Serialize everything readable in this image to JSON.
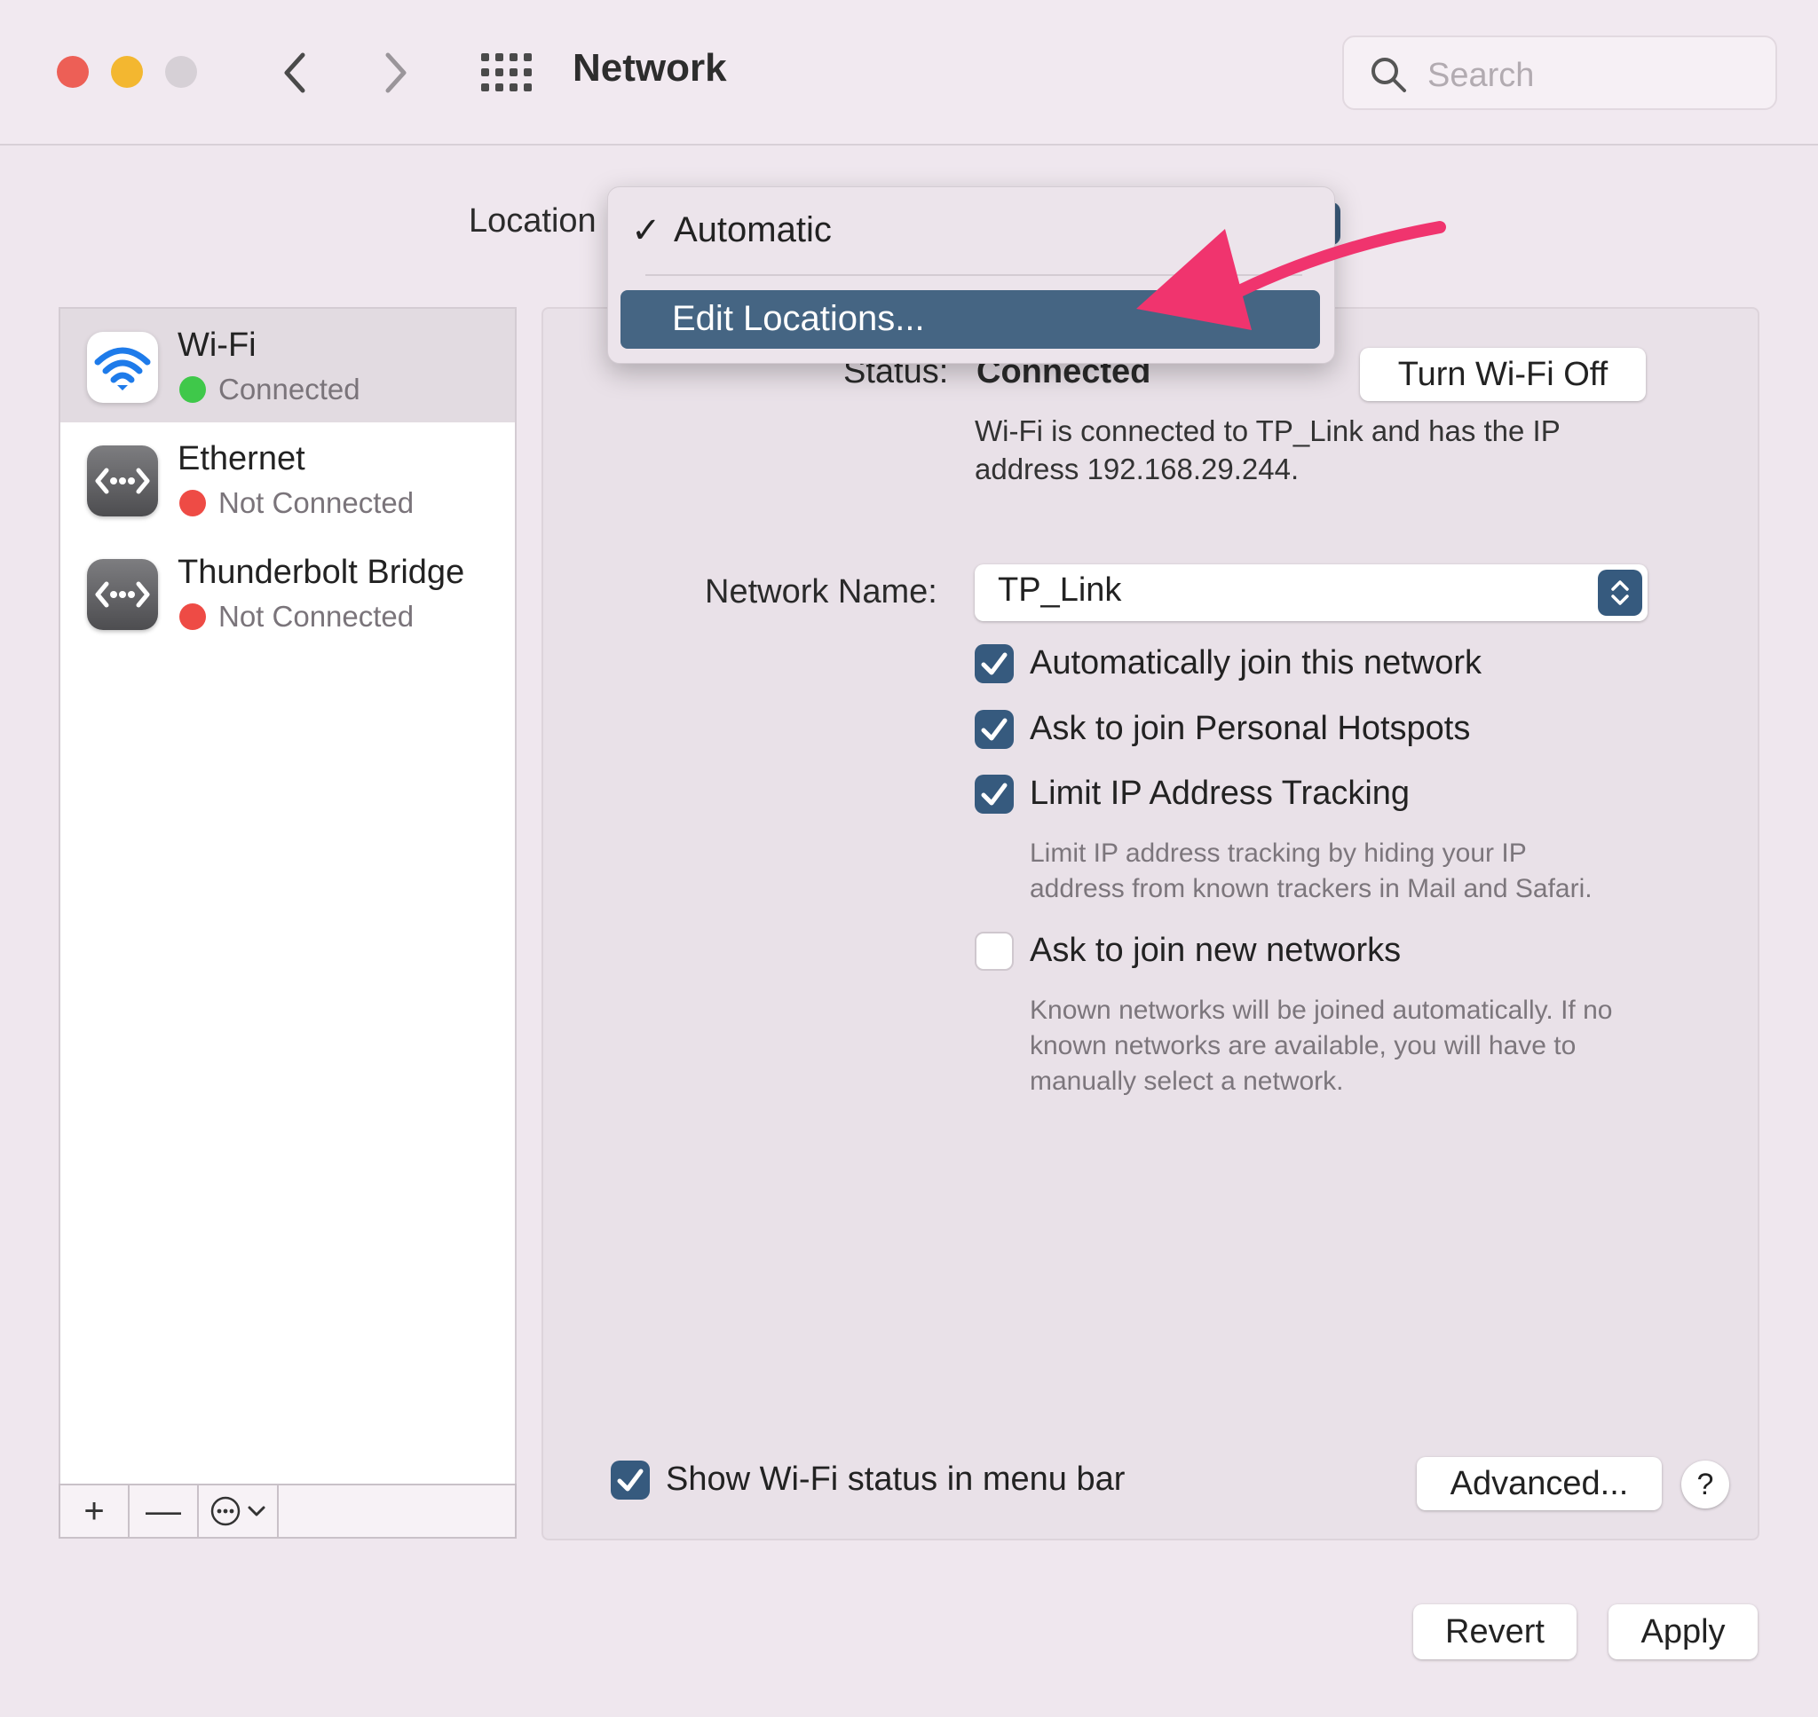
{
  "window": {
    "title": "Network",
    "search_placeholder": "Search"
  },
  "location": {
    "label": "Location",
    "menu": {
      "items": [
        {
          "label": "Automatic",
          "checked": true
        },
        {
          "label": "Edit Locations...",
          "highlighted": true
        }
      ]
    }
  },
  "sidebar": {
    "services": [
      {
        "name": "Wi-Fi",
        "status": "Connected",
        "status_color": "#3fc84a",
        "icon": "wifi-icon",
        "selected": true
      },
      {
        "name": "Ethernet",
        "status": "Not Connected",
        "status_color": "#ee4b45",
        "icon": "ethernet-icon"
      },
      {
        "name": "Thunderbolt Bridge",
        "status": "Not Connected",
        "status_color": "#ee4b45",
        "icon": "thunderbolt-bridge-icon"
      }
    ],
    "toolbar": {
      "add": "+",
      "remove": "—"
    }
  },
  "detail": {
    "status_label": "Status:",
    "status_value": "Connected",
    "turn_off_button": "Turn Wi-Fi Off",
    "status_info_line1": "Wi-Fi is connected to TP_Link and has the IP",
    "status_info_line2": "address 192.168.29.244.",
    "network_name_label": "Network Name:",
    "network_name_value": "TP_Link",
    "options": [
      {
        "label": "Automatically join this network",
        "checked": true
      },
      {
        "label": "Ask to join Personal Hotspots",
        "checked": true
      },
      {
        "label": "Limit IP Address Tracking",
        "checked": true
      },
      {
        "label": "Ask to join new networks",
        "checked": false
      }
    ],
    "limit_help_line1": "Limit IP address tracking by hiding your IP",
    "limit_help_line2": "address from known trackers in Mail and Safari.",
    "new_networks_help_line1": "Known networks will be joined automatically. If no",
    "new_networks_help_line2": "known networks are available, you will have to",
    "new_networks_help_line3": "manually select a network.",
    "show_status_label": "Show Wi-Fi status in menu bar",
    "show_status_checked": true,
    "advanced_button": "Advanced...",
    "help_button": "?"
  },
  "footer": {
    "revert_button": "Revert",
    "apply_button": "Apply"
  },
  "colors": {
    "accent": "#365a7e",
    "menu_highlight": "#456583",
    "annotation_arrow": "#f0346e"
  }
}
